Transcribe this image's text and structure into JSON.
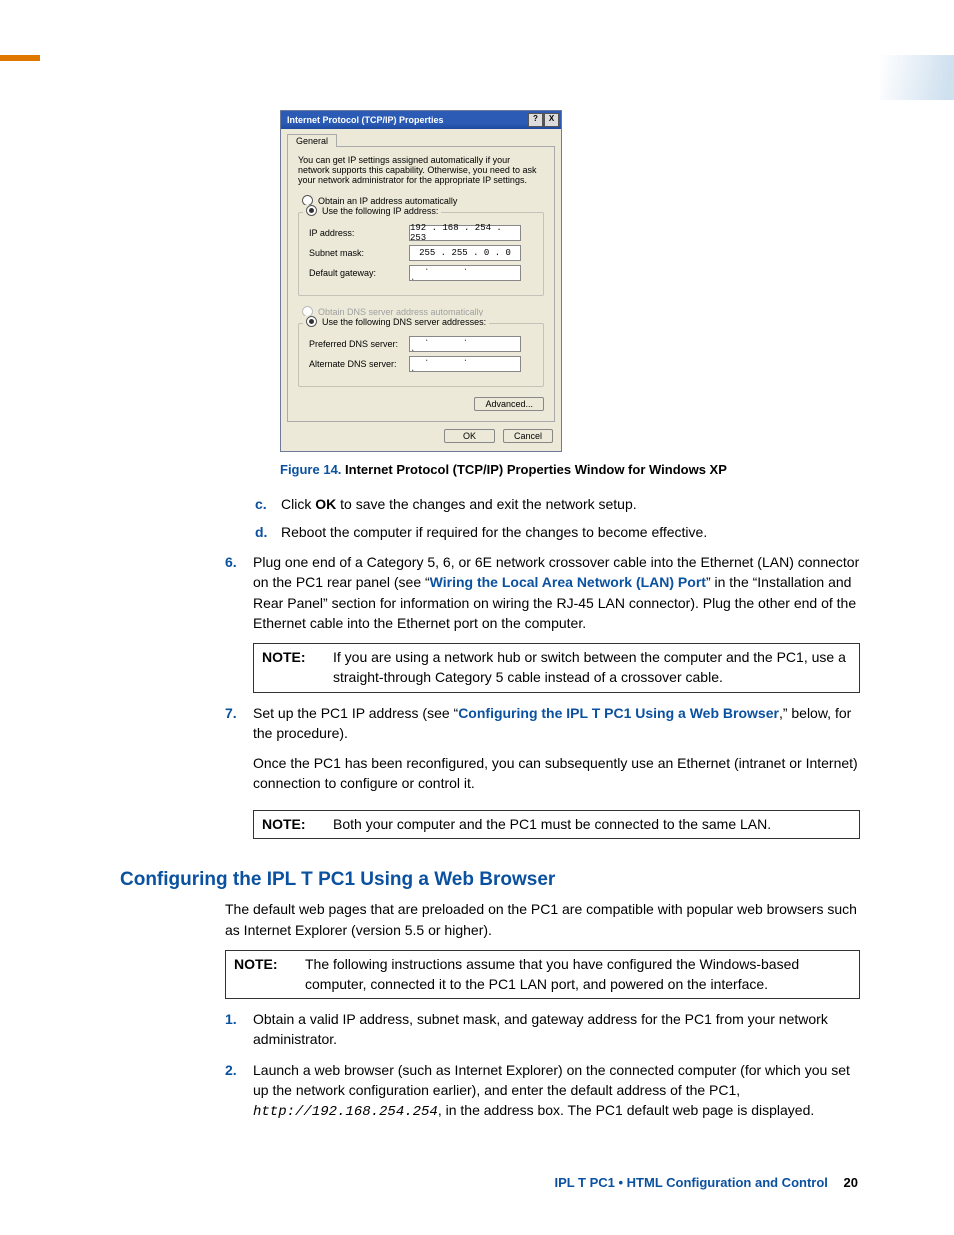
{
  "dialog": {
    "title": "Internet Protocol (TCP/IP) Properties",
    "help_btn": "?",
    "close_btn": "X",
    "tab": "General",
    "intro": "You can get IP settings assigned automatically if your network supports this capability. Otherwise, you need to ask your network administrator for the appropriate IP settings.",
    "radio_auto_ip": "Obtain an IP address automatically",
    "radio_use_ip": "Use the following IP address:",
    "ip_label": "IP address:",
    "ip_value": "192 . 168 . 254 . 253",
    "subnet_label": "Subnet mask:",
    "subnet_value": "255 . 255 .  0  .  0",
    "gateway_label": "Default gateway:",
    "gateway_value": ".   .   .",
    "radio_auto_dns": "Obtain DNS server address automatically",
    "radio_use_dns": "Use the following DNS server addresses:",
    "pref_dns_label": "Preferred DNS server:",
    "alt_dns_label": "Alternate DNS server:",
    "advanced_btn": "Advanced...",
    "ok_btn": "OK",
    "cancel_btn": "Cancel"
  },
  "caption": {
    "label": "Figure 14.",
    "text": "Internet Protocol (TCP/IP) Properties Window for Windows XP"
  },
  "steps_cd": {
    "c_marker": "c.",
    "c_pre": "Click ",
    "c_bold": "OK",
    "c_post": " to save the changes and exit the network setup.",
    "d_marker": "d.",
    "d_text": "Reboot the computer if required for the changes to become effective."
  },
  "step6": {
    "marker": "6.",
    "pre": "Plug one end of a Category 5, 6, or 6E network crossover cable into the Ethernet (LAN) connector on the PC1 rear panel (see “",
    "link": "Wiring the Local Area Network (LAN) Port",
    "post": "” in the “Installation and Rear Panel” section for information on wiring the RJ-45 LAN connector). Plug the other end of the Ethernet cable into the Ethernet port on the computer."
  },
  "note1": {
    "label": "NOTE:",
    "text": "If you are using a network hub or switch between the computer and the PC1, use a straight-through Category 5 cable instead of a crossover cable."
  },
  "step7": {
    "marker": "7.",
    "pre": "Set up the PC1 IP address (see “",
    "link": "Configuring the IPL T PC1 Using a Web Browser",
    "post": ",” below, for the procedure).",
    "follow": "Once the PC1 has been reconfigured, you can subsequently use an Ethernet (intranet or Internet) connection to configure or control it."
  },
  "note2": {
    "label": "NOTE:",
    "text": "Both your computer and the PC1 must be connected to the same LAN."
  },
  "section": {
    "heading": "Configuring the IPL T PC1 Using a Web Browser",
    "p1": "The default web pages that are preloaded on the PC1 are compatible with popular web browsers such as Internet Explorer (version 5.5 or higher).",
    "note": {
      "label": "NOTE:",
      "text": "The following instructions assume that you have configured the Windows-based computer, connected it to the PC1 LAN port, and powered on the interface."
    },
    "s1": {
      "marker": "1.",
      "text": "Obtain a valid IP address, subnet mask, and gateway address for the PC1 from your network administrator."
    },
    "s2": {
      "marker": "2.",
      "pre": "Launch a web browser (such as Internet Explorer) on the connected computer (for which you set up the network configuration earlier), and enter the default address of the PC1, ",
      "mono": "http://192.168.254.254",
      "post": ", in the address box. The PC1 default web page is displayed."
    }
  },
  "footer": {
    "text": "IPL T PC1 • HTML Configuration and Control",
    "page": "20"
  }
}
